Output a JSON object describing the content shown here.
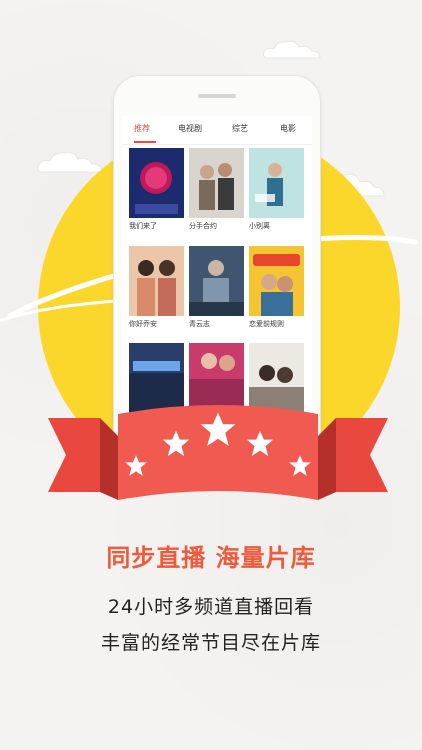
{
  "tabs": [
    {
      "label": "推荐",
      "active": true
    },
    {
      "label": "电视剧",
      "active": false
    },
    {
      "label": "综艺",
      "active": false
    },
    {
      "label": "电影",
      "active": false
    }
  ],
  "tiles": [
    {
      "title": "我们来了"
    },
    {
      "title": "分手合约"
    },
    {
      "title": "小别离"
    },
    {
      "title": "你好乔安"
    },
    {
      "title": "青云志"
    },
    {
      "title": "恋爱前规则"
    },
    {
      "title": ""
    },
    {
      "title": ""
    },
    {
      "title": ""
    }
  ],
  "nav": {
    "icons": [
      "home-icon",
      "tv-icon",
      "play-icon",
      "user-icon"
    ]
  },
  "headline": "同步直播 海量片库",
  "sublines": [
    "24小时多频道直播回看",
    "丰富的经常节目尽在片库"
  ],
  "colors": {
    "accent": "#f14a3d",
    "sun": "#fcd72b",
    "ribbon": "#ef5a4e",
    "headline": "#ef5a3c"
  }
}
